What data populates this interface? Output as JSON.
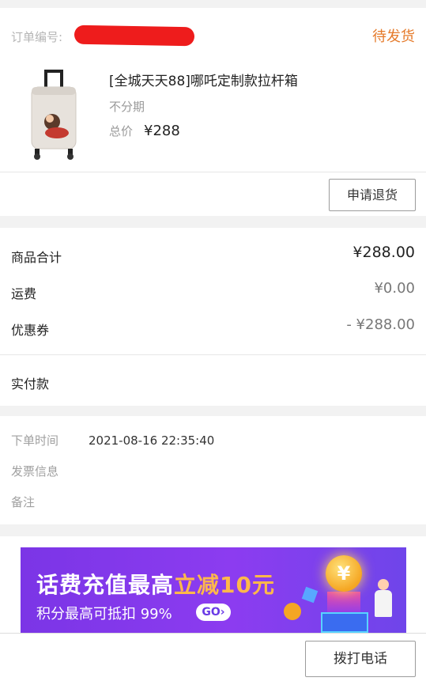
{
  "order": {
    "number_label": "订单编号:",
    "status": "待发货",
    "product": {
      "title": "[全城天天88]哪吒定制款拉杆箱",
      "spec": "不分期",
      "price_label": "总价",
      "price": "¥288"
    },
    "refund_button": "申请退货"
  },
  "summary": {
    "rows": [
      {
        "label": "商品合计",
        "value": "¥288.00"
      },
      {
        "label": "运费",
        "value": "¥0.00"
      },
      {
        "label": "优惠券",
        "value": "- ¥288.00"
      }
    ],
    "paid_label": "实付款"
  },
  "info": {
    "rows": [
      {
        "label": "下单时间",
        "value": "2021-08-16 22:35:40"
      },
      {
        "label": "发票信息",
        "value": ""
      },
      {
        "label": "备注",
        "value": ""
      }
    ]
  },
  "banner": {
    "title_part1": "话费充值最高",
    "title_highlight": "立减10元",
    "subtitle": "积分最高可抵扣 99%",
    "go_label": "GO›",
    "coin_symbol": "¥"
  },
  "bottom": {
    "call_button": "拨打电话"
  },
  "colors": {
    "status": "#e57a2a",
    "banner_bg": "#8c3cf0",
    "banner_highlight": "#ffb84a",
    "redaction": "#ee1c1c"
  },
  "icons": {
    "product_image": "luggage-suitcase-image"
  }
}
